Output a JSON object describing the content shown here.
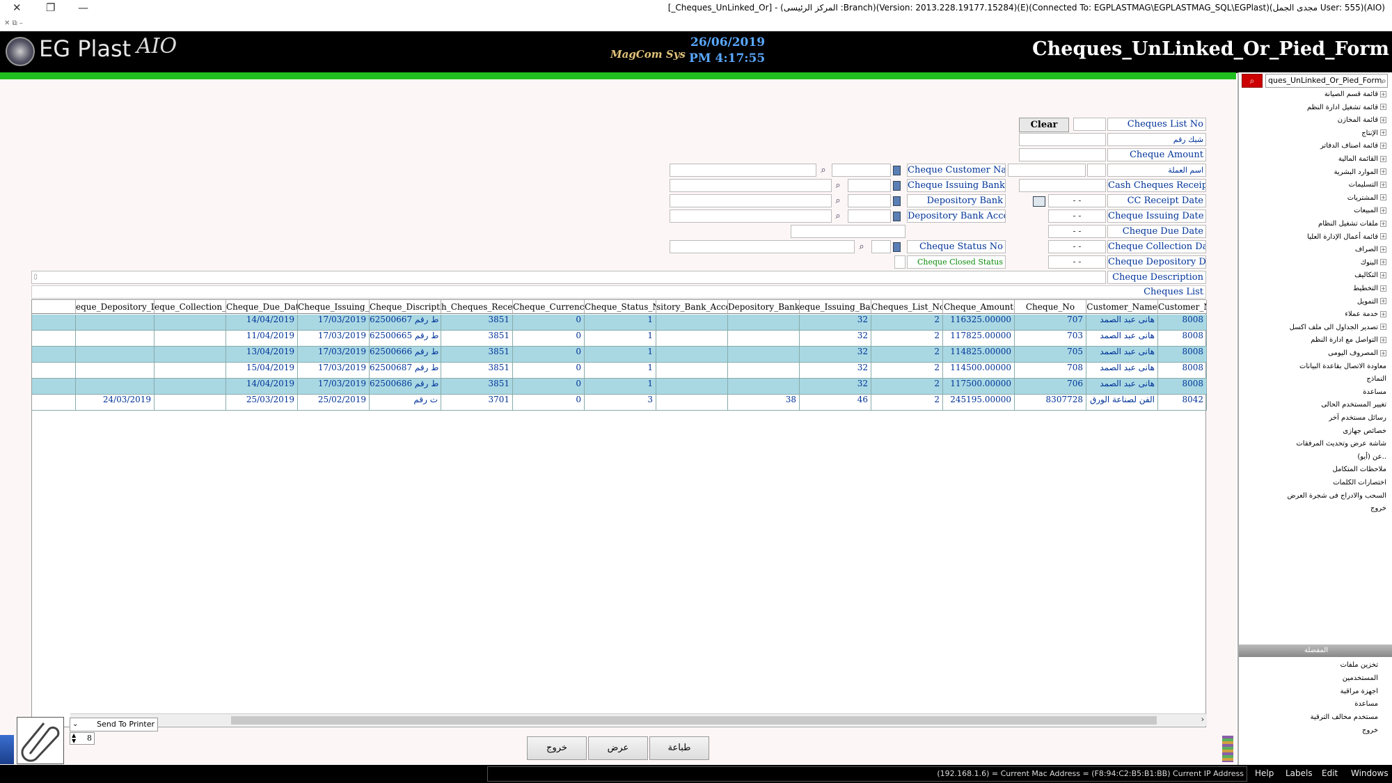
{
  "window": {
    "title": "[_Cheques_UnLinked_Or] - (المركز الرئيسى :Branch)(Version: 2013.228.19177.15284)(E)(Connected To: EGPLASTMAG\\EGPLASTMAG_SQL\\EGPlast)(مجدى الجمل User: 555)(AIO)",
    "close_glyph": "✕",
    "restore_glyph": "❐",
    "minimize_glyph": "—",
    "small_controls": "✕  ⧉  –"
  },
  "header": {
    "logo_text": "EG Plast",
    "logo_suffix": "AIO",
    "mag_text": "MagCom Sys",
    "date": "26/06/2019",
    "time": "PM 4:17:55",
    "form_title": "Cheques_UnLinked_Or_Pied_Form"
  },
  "form": {
    "clear_label": "Clear",
    "labels": {
      "cheques_list_no": "Cheques List No",
      "cheque_no": "شيك رقم",
      "cheque_amount": "Cheque Amount",
      "currency_name": "اسم العملة",
      "cash_receipt_no": "Cash Cheques Receipt No",
      "cc_receipt_date": "CC Receipt Date",
      "issuing_date": "Cheque Issuing Date",
      "due_date": "Cheque Due Date",
      "collection_date": "Cheque Collection Date",
      "depository_date": "Cheque Depository Date",
      "description": "Cheque Description",
      "cheques_list": "Cheques List",
      "customer_name": "Cheque Customer Nam",
      "issuing_bank": "Cheque Issuing Bank",
      "depository_bank": "Depository Bank",
      "depository_account": "Depository Bank Account",
      "status_no": "Cheque Status No",
      "closed_status": "Cheque Closed Status"
    },
    "date_placeholder": "- -"
  },
  "grid": {
    "columns": [
      "Customer_No",
      "Customer_Name",
      "Cheque_No",
      "Cheque_Amount",
      "Cheques_List_No",
      "eque_Issuing_Bank_",
      "Depository_Bank_No",
      "sitory_Bank_Accour",
      "Cheque_Status_No",
      "Cheque_Currency_No",
      "h_Cheques_Receipt_",
      "Cheque_Discription",
      "Cheque_Issuing_Date",
      "Cheque_Due_Date",
      "eque_Collection_Da",
      "eque_Depository_Da"
    ],
    "rows": [
      {
        "customer_no": "8008",
        "customer_name": "هانى عبد الصمد",
        "cheque_no": "707",
        "amount": "116325.00000",
        "list_no": "2",
        "issuing_bank": "32",
        "dep_bank": "",
        "dep_account": "",
        "status": "1",
        "currency": "0",
        "receipt": "3851",
        "description": "ط رقم 62500667",
        "issuing_date": "17/03/2019",
        "due_date": "14/04/2019",
        "collection_date": "",
        "depository_date": ""
      },
      {
        "customer_no": "8008",
        "customer_name": "هانى عبد الصمد",
        "cheque_no": "703",
        "amount": "117825.00000",
        "list_no": "2",
        "issuing_bank": "32",
        "dep_bank": "",
        "dep_account": "",
        "status": "1",
        "currency": "0",
        "receipt": "3851",
        "description": "ط رقم 62500665",
        "issuing_date": "17/03/2019",
        "due_date": "11/04/2019",
        "collection_date": "",
        "depository_date": ""
      },
      {
        "customer_no": "8008",
        "customer_name": "هانى عبد الصمد",
        "cheque_no": "705",
        "amount": "114825.00000",
        "list_no": "2",
        "issuing_bank": "32",
        "dep_bank": "",
        "dep_account": "",
        "status": "1",
        "currency": "0",
        "receipt": "3851",
        "description": "ط رقم 62500666",
        "issuing_date": "17/03/2019",
        "due_date": "13/04/2019",
        "collection_date": "",
        "depository_date": ""
      },
      {
        "customer_no": "8008",
        "customer_name": "هانى عبد الصمد",
        "cheque_no": "708",
        "amount": "114500.00000",
        "list_no": "2",
        "issuing_bank": "32",
        "dep_bank": "",
        "dep_account": "",
        "status": "1",
        "currency": "0",
        "receipt": "3851",
        "description": "ط رقم 62500687",
        "issuing_date": "17/03/2019",
        "due_date": "15/04/2019",
        "collection_date": "",
        "depository_date": ""
      },
      {
        "customer_no": "8008",
        "customer_name": "هانى عبد الصمد",
        "cheque_no": "706",
        "amount": "117500.00000",
        "list_no": "2",
        "issuing_bank": "32",
        "dep_bank": "",
        "dep_account": "",
        "status": "1",
        "currency": "0",
        "receipt": "3851",
        "description": "ط رقم 62500686",
        "issuing_date": "17/03/2019",
        "due_date": "14/04/2019",
        "collection_date": "",
        "depository_date": ""
      },
      {
        "customer_no": "8042",
        "customer_name": "الفن لصناعة الورق",
        "cheque_no": "8307728",
        "amount": "245195.00000",
        "list_no": "2",
        "issuing_bank": "46",
        "dep_bank": "38",
        "dep_account": "",
        "status": "3",
        "currency": "0",
        "receipt": "3701",
        "description": "ت رقم",
        "issuing_date": "25/02/2019",
        "due_date": "25/03/2019",
        "collection_date": "",
        "depository_date": "24/03/2019"
      }
    ]
  },
  "buttons": {
    "print": "طباعة",
    "view": "عرض",
    "exit": "خروج"
  },
  "printer": {
    "target": "Send To Printer",
    "copies": "8"
  },
  "sidebar": {
    "search_value": "ques_UnLinked_Or_Pied_Form",
    "items": [
      {
        "label": "قائمة قسم الصيانة",
        "expandable": true
      },
      {
        "label": "قائمة تشغيل ادارة النظم",
        "expandable": true
      },
      {
        "label": "قائمة المخازن",
        "expandable": true
      },
      {
        "label": "الإنتاج",
        "expandable": true
      },
      {
        "label": "قائمة اصناف الدفاتر",
        "expandable": true
      },
      {
        "label": "القائمة المالية",
        "expandable": true
      },
      {
        "label": "الموارد البشرية",
        "expandable": true
      },
      {
        "label": "التسليمات",
        "expandable": true
      },
      {
        "label": "المشتريات",
        "expandable": true
      },
      {
        "label": "المبيعات",
        "expandable": true
      },
      {
        "label": "ملفات تشغيل النظام",
        "expandable": true
      },
      {
        "label": "قائمة أعمال الإدارة العليا",
        "expandable": true
      },
      {
        "label": "الصراف",
        "expandable": true
      },
      {
        "label": "البنوك",
        "expandable": true
      },
      {
        "label": "التكاليف",
        "expandable": true
      },
      {
        "label": "التخطيط",
        "expandable": true
      },
      {
        "label": "التمويل",
        "expandable": true
      },
      {
        "label": "خدمة عملاء",
        "expandable": true
      },
      {
        "label": "تصدير الجداول الى ملف اكسل",
        "expandable": true
      },
      {
        "label": "التواصل مع ادارة النظم",
        "expandable": true
      },
      {
        "label": "المصروف اليومى",
        "expandable": true
      },
      {
        "label": "معاودة الاتصال بقاعدة البيانات",
        "expandable": false
      },
      {
        "label": "النماذج",
        "expandable": false
      },
      {
        "label": "مساعدة",
        "expandable": false
      },
      {
        "label": "تغيير المستخدم الحالى",
        "expandable": false
      },
      {
        "label": "رسائل مستخدم آخر",
        "expandable": false
      },
      {
        "label": "خصائص جهازى",
        "expandable": false
      },
      {
        "label": "شاشة عرض وتحديث المرفقات",
        "expandable": false
      },
      {
        "label": "عن (أيو)..",
        "expandable": false
      },
      {
        "label": "ملاحظات المتكامل",
        "expandable": false
      },
      {
        "label": "اختصارات الكلمات",
        "expandable": false
      },
      {
        "label": "السحب والادراج فى شجرة العرض",
        "expandable": false
      },
      {
        "label": "خروج",
        "expandable": false
      }
    ],
    "favorites_title": "المفضلة",
    "favorites": [
      "تخزين ملفات",
      "المستخدمين",
      "اجهزة مراقبة",
      "مساعدة",
      "مستخدم مخالف الترقية",
      "خروج"
    ]
  },
  "statusbar": {
    "text": "(192.168.1.6) = Current Mac Address = (F8:94:C2:B5:B1:BB) Current IP Address",
    "menus": [
      "Help",
      "Labels",
      "Edit",
      "Windows"
    ]
  },
  "colors": {
    "header_bg": "#000000",
    "green_bar": "#1fbf1f",
    "row_highlight": "#a9d8e3",
    "label_text": "#003399",
    "date_text": "#5aa8ff"
  }
}
